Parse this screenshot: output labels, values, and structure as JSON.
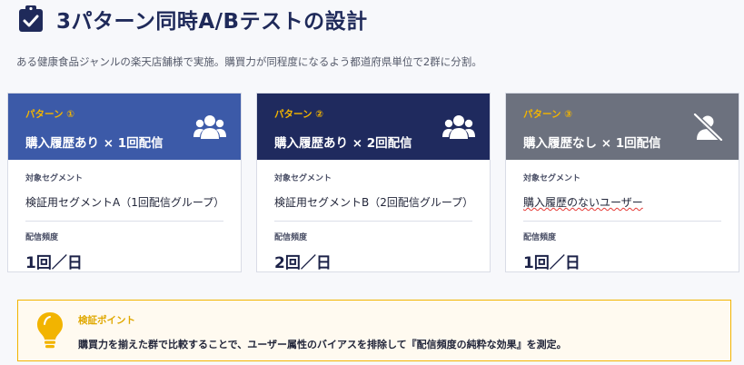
{
  "header": {
    "icon": "clipboard-check-icon",
    "title": "3パターン同時A/Bテストの設計",
    "subtitle": "ある健康食品ジャンルの楽天店舗様で実施。購買力が同程度になるよう都道府県単位で2群に分割。"
  },
  "colors": {
    "pattern1": "#3c5aa8",
    "pattern2": "#1f2a5e",
    "pattern3": "#6c717e",
    "accent": "#f2b400"
  },
  "patterns": [
    {
      "number": "パターン ①",
      "title": "購入履歴あり × 1回配信",
      "icon": "users-icon",
      "segment_label": "対象セグメント",
      "segment": "検証用セグメントA（1回配信グループ）",
      "frequency_label": "配信頻度",
      "frequency": "1回／日"
    },
    {
      "number": "パターン ②",
      "title": "購入履歴あり × 2回配信",
      "icon": "users-icon",
      "segment_label": "対象セグメント",
      "segment": "検証用セグメントB（2回配信グループ）",
      "frequency_label": "配信頻度",
      "frequency": "2回／日"
    },
    {
      "number": "パターン ③",
      "title": "購入履歴なし × 1回配信",
      "icon": "user-slash-icon",
      "segment_label": "対象セグメント",
      "segment": "購入履歴のないユーザー",
      "frequency_label": "配信頻度",
      "frequency": "1回／日"
    }
  ],
  "point": {
    "icon": "lightbulb-icon",
    "title": "検証ポイント",
    "text": "購買力を揃えた群で比較することで、ユーザー属性のバイアスを排除して『配信頻度の純粋な効果』を測定。"
  }
}
